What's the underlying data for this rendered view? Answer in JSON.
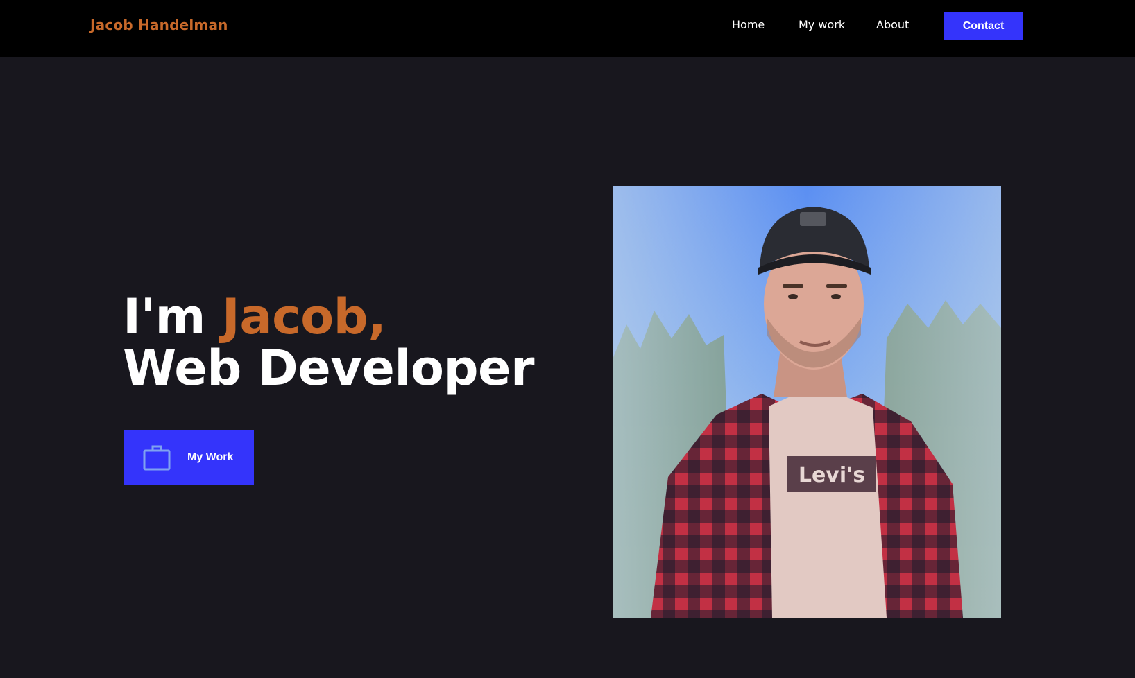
{
  "header": {
    "brand": "Jacob Handelman",
    "nav": [
      "Home",
      "My work",
      "About"
    ],
    "contact_label": "Contact"
  },
  "hero": {
    "greeting": "I'm ",
    "name": "Jacob,",
    "role": "Web Developer",
    "cta_label": "My Work",
    "cta_icon": "briefcase-icon"
  },
  "portrait": {
    "shirt_text": "Levi's"
  },
  "colors": {
    "accent": "#c8692a",
    "button": "#3434fb",
    "background": "#18171e",
    "header": "#000000"
  }
}
